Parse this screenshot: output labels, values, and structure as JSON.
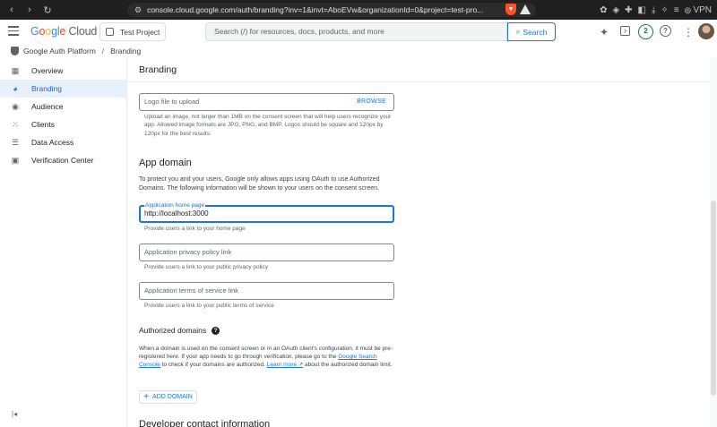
{
  "browser": {
    "url": "console.cloud.google.com/auth/branding?inv=1&invt=AboEVw&organizationId=0&project=test-pro...",
    "vpn_label": "VPN"
  },
  "header": {
    "logo_google": [
      "G",
      "o",
      "o",
      "g",
      "l",
      "e"
    ],
    "logo_cloud": "Cloud",
    "project_label": "Test Project",
    "search_placeholder": "Search (/) for resources, docs, products, and more",
    "search_button": "Search",
    "notifications_count": "2",
    "help_symbol": "?"
  },
  "breadcrumb": {
    "product": "Google Auth Platform",
    "separator": "/",
    "page": "Branding"
  },
  "sidebar": {
    "items": [
      {
        "label": "Overview",
        "icon": "dashboard-icon"
      },
      {
        "label": "Branding",
        "icon": "palette-icon",
        "active": true
      },
      {
        "label": "Audience",
        "icon": "person-icon"
      },
      {
        "label": "Clients",
        "icon": "grid-icon"
      },
      {
        "label": "Data Access",
        "icon": "list-icon"
      },
      {
        "label": "Verification Center",
        "icon": "checklist-icon"
      }
    ],
    "collapse_icon": "collapse-sidebar-icon"
  },
  "main": {
    "title": "Branding",
    "logo_field": {
      "placeholder": "Logo file to upload",
      "browse_label": "BROWSE",
      "helper": "Upload an image, not larger than 1MB on the consent screen that will help users recognize your app. Allowed image formats are JPG, PNG, and BMP. Logos should be square and 120px by 120px for the best results."
    },
    "app_domain": {
      "heading": "App domain",
      "description": "To protect you and your users, Google only allows apps using OAuth to use Authorized Domains. The following information will be shown to your users on the consent screen.",
      "home_page": {
        "label": "Application home page",
        "value": "http://localhost:3000",
        "helper": "Provide users a link to your home page"
      },
      "privacy_policy": {
        "placeholder": "Application privacy policy link",
        "helper": "Provide users a link to your public privacy policy"
      },
      "terms_of_service": {
        "placeholder": "Application terms of service link",
        "helper": "Provide users a link to your public terms of service"
      }
    },
    "authorized_domains": {
      "heading": "Authorized domains",
      "help_symbol": "?",
      "text_1": "When a domain is used on the consent screen or in an OAuth client's configuration, it must be pre-registered here. If your app needs to go through verification, please go to the ",
      "link_1": "Google Search Console",
      "text_2": " to check if your domains are authorized. ",
      "link_2": "Learn more",
      "text_3": " about the authorized domain limit.",
      "add_button": "ADD DOMAIN"
    },
    "developer_contact": {
      "heading": "Developer contact information"
    }
  },
  "colors": {
    "accent": "#1a73e8",
    "active_bg": "#e8f0fe",
    "badge": "#188038"
  }
}
